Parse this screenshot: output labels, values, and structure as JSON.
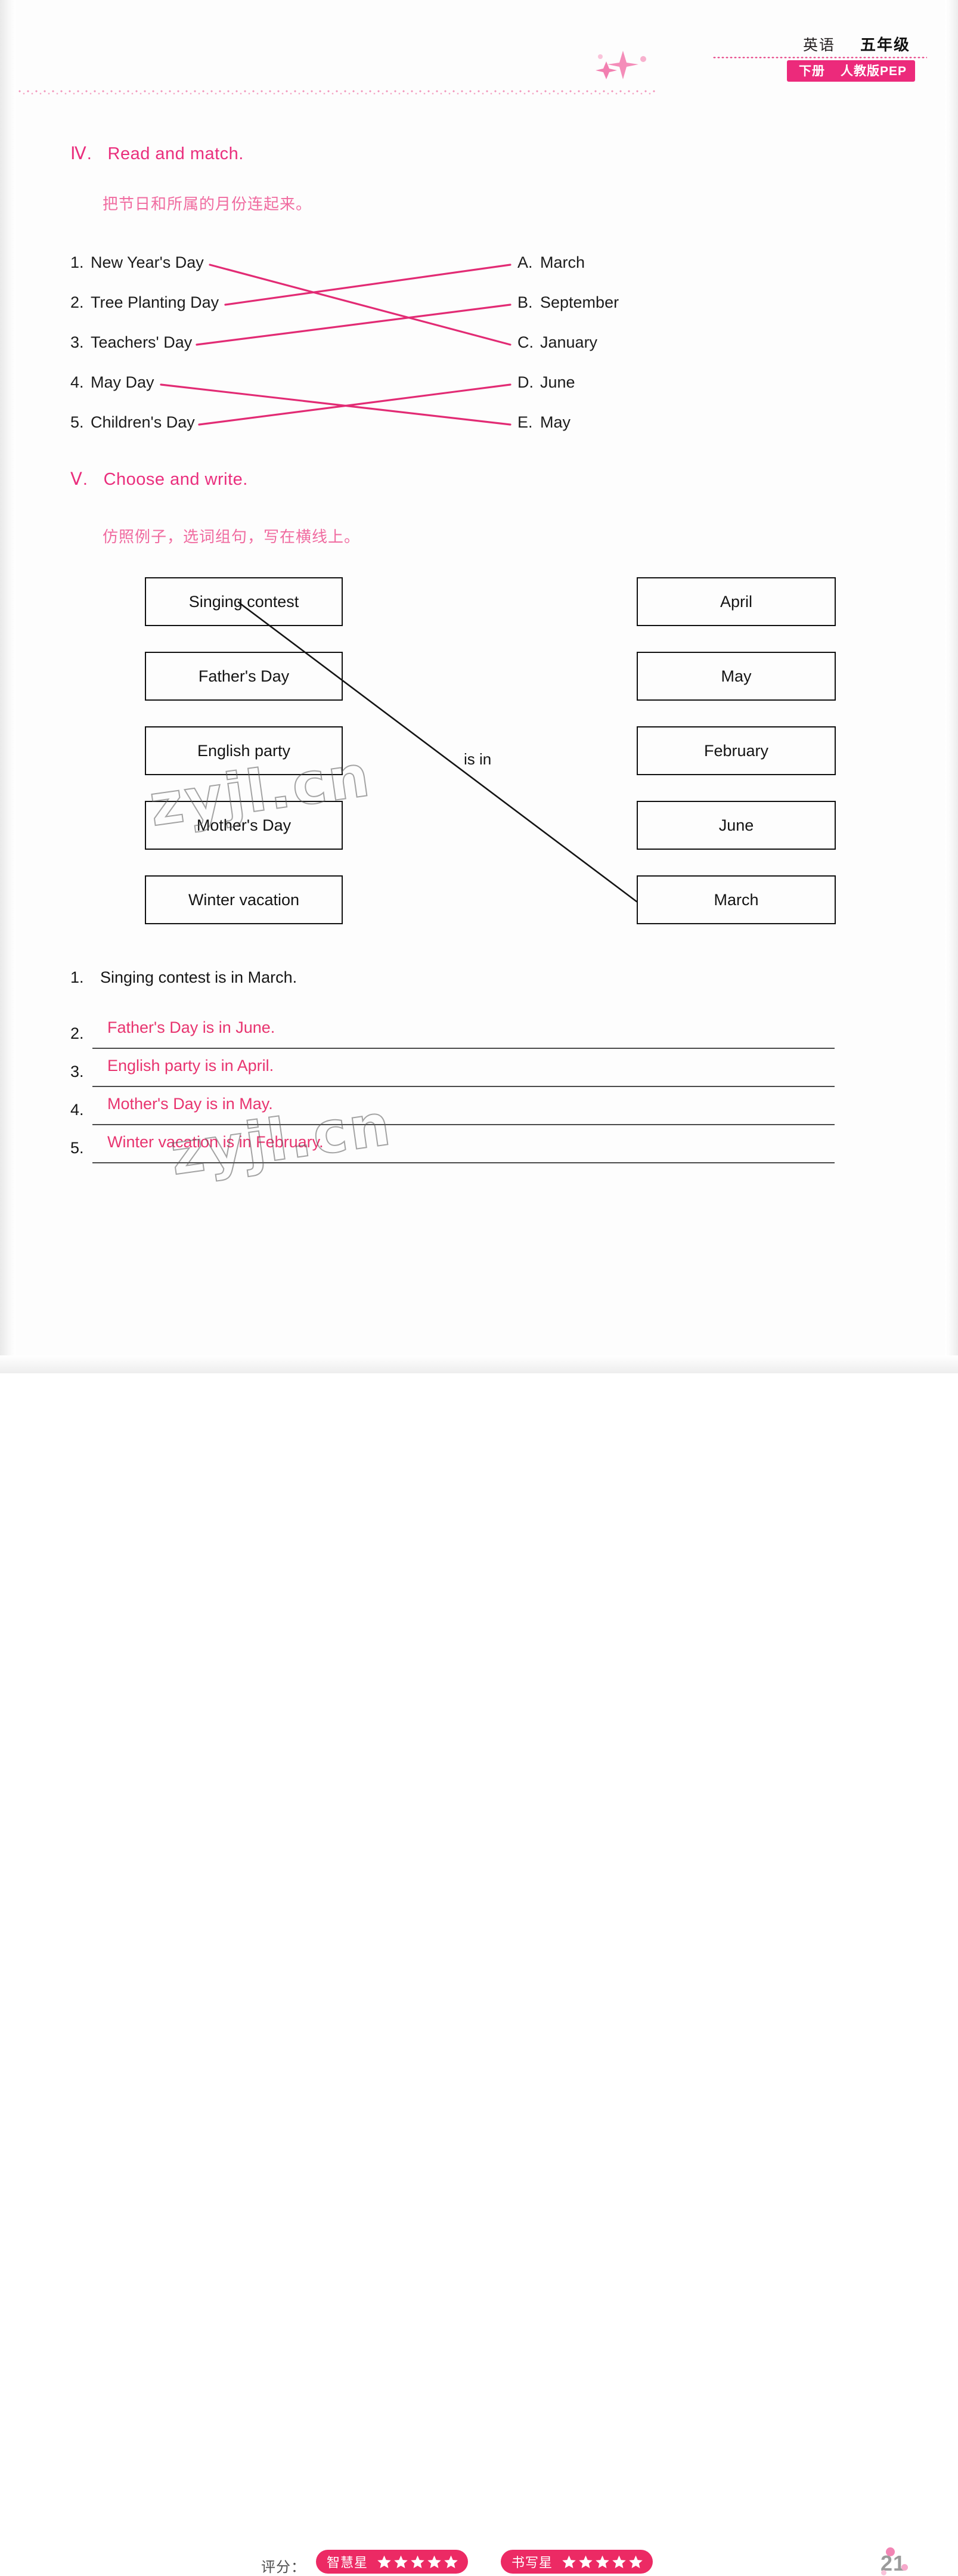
{
  "header": {
    "subject": "英语",
    "grade": "五年级",
    "volume": "下册",
    "edition": "人教版PEP"
  },
  "sections": [
    {
      "number": "Ⅳ.",
      "title": "Read and match.",
      "instruction_cn": "把节日和所属的月份连起来。",
      "left_items": [
        {
          "num": "1.",
          "label": "New Year's Day"
        },
        {
          "num": "2.",
          "label": "Tree Planting Day"
        },
        {
          "num": "3.",
          "label": "Teachers' Day"
        },
        {
          "num": "4.",
          "label": "May Day"
        },
        {
          "num": "5.",
          "label": "Children's Day"
        }
      ],
      "right_items": [
        {
          "ltr": "A.",
          "label": "March"
        },
        {
          "ltr": "B.",
          "label": "September"
        },
        {
          "ltr": "C.",
          "label": "January"
        },
        {
          "ltr": "D.",
          "label": "June"
        },
        {
          "ltr": "E.",
          "label": "May"
        }
      ],
      "matches": [
        {
          "from": 1,
          "to": "C"
        },
        {
          "from": 2,
          "to": "A"
        },
        {
          "from": 3,
          "to": "B"
        },
        {
          "from": 4,
          "to": "E"
        },
        {
          "from": 5,
          "to": "D"
        }
      ]
    },
    {
      "number": "Ⅴ.",
      "title": "Choose and write.",
      "instruction_cn": "仿照例子，选词组句，写在横线上。",
      "connector": "is in",
      "left_boxes": [
        "Singing contest",
        "Father's Day",
        "English party",
        "Mother's Day",
        "Winter vacation"
      ],
      "right_boxes": [
        "April",
        "May",
        "February",
        "June",
        "March"
      ],
      "drawn_match": {
        "from": "Singing contest",
        "to": "March"
      },
      "answers": [
        {
          "num": "1.",
          "text": "Singing contest is in March.",
          "style": "printed"
        },
        {
          "num": "2.",
          "text": "Father's Day is in June.",
          "style": "handwritten"
        },
        {
          "num": "3.",
          "text": "English party is in April.",
          "style": "handwritten"
        },
        {
          "num": "4.",
          "text": "Mother's Day is in May.",
          "style": "handwritten"
        },
        {
          "num": "5.",
          "text": "Winter vacation is in February.",
          "style": "handwritten"
        }
      ]
    }
  ],
  "watermark": "zyjl.cn",
  "footer": {
    "score_label": "评分：",
    "badges": [
      {
        "label": "智慧星",
        "stars": 5
      },
      {
        "label": "书写星",
        "stars": 5
      }
    ],
    "page_number": "21"
  },
  "colors": {
    "pink": "#ea2e7d",
    "pink_light": "#f06ba0",
    "band": "#ec2a7b",
    "ink": "#161616"
  }
}
